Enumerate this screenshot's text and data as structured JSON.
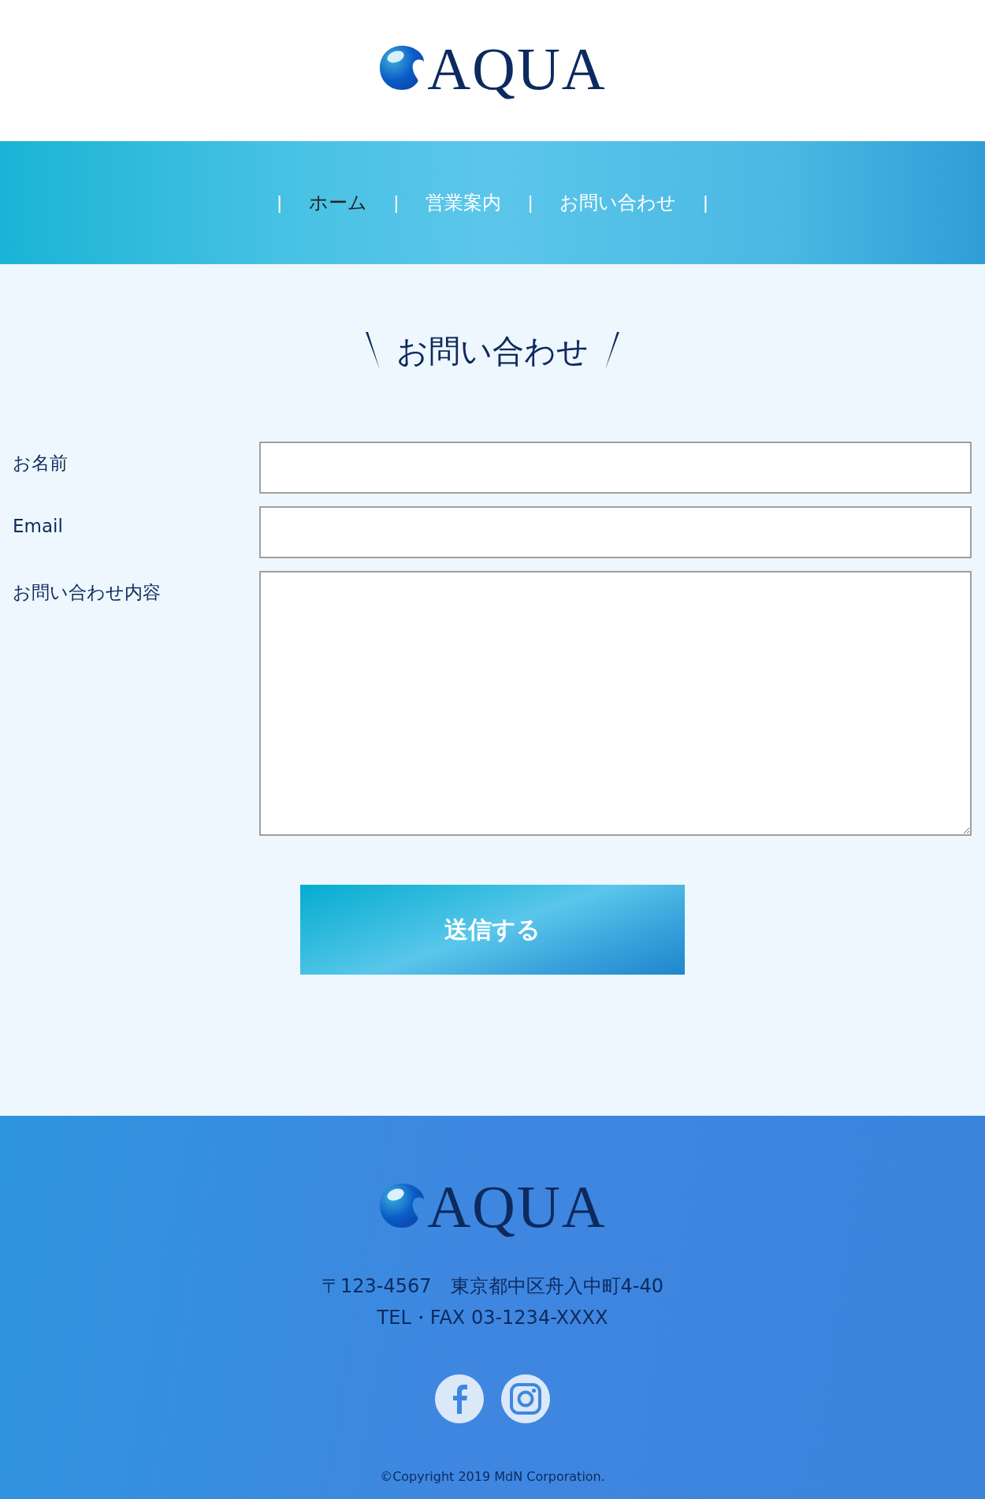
{
  "header": {
    "logo_text": "AQUA"
  },
  "nav": {
    "separator": "|",
    "items": [
      {
        "label": "ホーム",
        "selected": true
      },
      {
        "label": "営業案内",
        "selected": false
      },
      {
        "label": "お問い合わせ",
        "selected": false
      }
    ]
  },
  "page_title": "お問い合わせ",
  "form": {
    "fields": [
      {
        "label": "お名前",
        "kind": "text"
      },
      {
        "label": "Email",
        "kind": "text"
      },
      {
        "label": "お問い合わせ内容",
        "kind": "textarea"
      }
    ],
    "submit": "送信する"
  },
  "footer": {
    "logo_text": "AQUA",
    "address": "〒123-4567　東京都中区舟入中町4-40",
    "phone": "TEL・FAX 03-1234-XXXX",
    "social": [
      {
        "kind": "facebook"
      },
      {
        "kind": "instagram"
      }
    ],
    "copyright": "©Copyright 2019 MdN Corporation."
  }
}
